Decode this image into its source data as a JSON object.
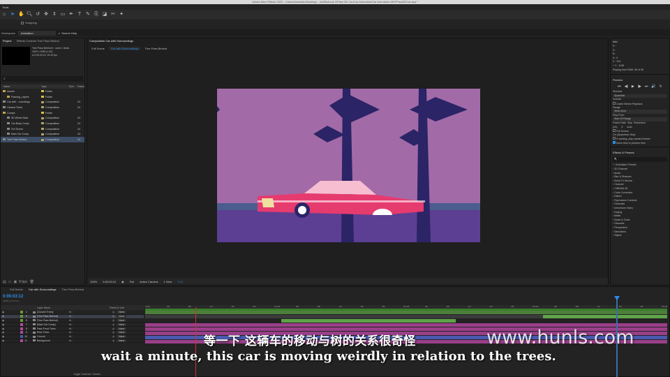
{
  "window": {
    "title": "Adobe After Effects 2023 - /Users/shunlsdn/Desktop/.../to/Bitchunk 2/Pass 3D Car/Car Animation/Car Animation AE/FPass3DCar.aep *"
  },
  "tools": {
    "label": "Tools",
    "items": [
      "home-icon",
      "selection-icon",
      "hand-icon",
      "zoom-icon",
      "orbit-icon",
      "pan-icon",
      "dolly-icon",
      "rectangle-icon",
      "pen-icon",
      "type-icon",
      "brush-icon",
      "clone-icon",
      "eraser-icon",
      "roto-icon",
      "puppet-icon"
    ],
    "snapping_label": "Snapping"
  },
  "workspace": {
    "label": "Workspace",
    "current": "Animation",
    "search_placeholder": "Search Help"
  },
  "project": {
    "tabs": [
      "Project",
      "Effects Controls Tree Pass Behind"
    ],
    "selected_name": "Tree Pass Behind ▾ , used 1 times",
    "selected_size": "1920 x 1080 (1.00)",
    "selected_duration": "Δ 0:00:03:10, 24.00 fps",
    "columns": [
      "Name",
      "Type",
      "Size",
      "Frame"
    ],
    "rows": [
      {
        "name": "Assets",
        "type": "Folder",
        "size": "",
        "kind": "folder",
        "indent": 0,
        "swatch": "#d8c14a"
      },
      {
        "name": "Flaming_Layers",
        "type": "Folder",
        "size": "",
        "kind": "folder",
        "indent": 1,
        "swatch": "#d8c14a"
      },
      {
        "name": "Car with ...roundings",
        "type": "Composition",
        "size": "24",
        "kind": "comp",
        "indent": 0,
        "swatch": "#b0a46a"
      },
      {
        "name": "Closest Trees",
        "type": "Composition",
        "size": "24",
        "kind": "comp",
        "indent": 0,
        "swatch": "#b0a46a"
      },
      {
        "name": "Comps",
        "type": "Folder",
        "size": "",
        "kind": "folder",
        "indent": 0,
        "swatch": "#d8c14a"
      },
      {
        "name": "3D Wheel Start",
        "type": "Composition",
        "size": "24",
        "kind": "comp",
        "indent": 1,
        "swatch": "#b0a46a"
      },
      {
        "name": "Car Body Comp",
        "type": "Composition",
        "size": "24",
        "kind": "comp",
        "indent": 1,
        "swatch": "#b0a46a"
      },
      {
        "name": "Full Scene",
        "type": "Composition",
        "size": "24",
        "kind": "comp",
        "indent": 1,
        "swatch": "#b0a46a"
      },
      {
        "name": "Main Car Comp",
        "type": "Composition",
        "size": "24",
        "kind": "comp",
        "indent": 1,
        "swatch": "#b0a46a"
      },
      {
        "name": "Tree Pass Behind",
        "type": "Composition",
        "size": "24",
        "kind": "comp",
        "indent": 0,
        "swatch": "#b0a46a",
        "selected": true
      }
    ],
    "footer_bpc": "8 bpc"
  },
  "viewer": {
    "tab_label": "Composition Car with Surroundings",
    "breadcrumbs": [
      "Full Scene",
      "Car with Surroundings",
      "Tree Pass Behind"
    ],
    "current_breadcrumb": "Car with Surroundings",
    "footer": {
      "zoom": "100%",
      "timecode": "0:00:03:12",
      "resolution": "Full",
      "camera": "Active Camera",
      "views": "1 View",
      "exposure": "+0.0"
    },
    "colors": {
      "sky": "#a36aa8",
      "ground": "#5c3f92",
      "horizon": "#4a5d8e",
      "trees": "#2b2466",
      "car": "#e63b6e",
      "car_roof": "#f6bed0"
    }
  },
  "info": {
    "title": "Info",
    "lines": [
      "R :",
      "G :",
      "B :",
      "A : 0",
      "X : 312",
      "+ Y : 1138",
      "Playing from RAM: 38 of 96"
    ]
  },
  "preview": {
    "title": "Preview",
    "transport": [
      "⏮",
      "◀|",
      "▶",
      "|▶",
      "⏭",
      "🔊",
      "↻"
    ],
    "shortcut_label": "Shortcut",
    "shortcut_value": "Spacebar",
    "include_label": "Include:",
    "cache_label": "Cache Before Playback",
    "range_label": "Range",
    "range_value": "Work Area",
    "play_from_label": "Play From",
    "play_from_value": "Start Of Range",
    "frame_rate_label": "Frame Rate",
    "skip_label": "Skip",
    "resolution_label": "Resolution",
    "frame_rate_value": "(24)",
    "skip_value": "0",
    "resolution_value": "Auto",
    "fullscreen_label": "Full Screen",
    "stop_label": "On (Spacebar) Stop:",
    "stop_opt1": "If caching, play cached frames",
    "stop_opt2": "Move time to preview time"
  },
  "effects": {
    "title": "Effects & Presets",
    "search_placeholder": "🔍",
    "items": [
      "* Animation Presets",
      "3D Channel",
      "Audio",
      "Blur & Sharpen",
      "Boris FX Mocha",
      "Channel",
      "CINEMA 4D",
      "Color Correction",
      "Distort",
      "Expression Controls",
      "Generate",
      "Immersive Video",
      "Keying",
      "Matte",
      "Noise & Grain",
      "Obsolete",
      "Perspective",
      "Simulation",
      "Stylize"
    ]
  },
  "timeline": {
    "tabs": [
      "Full Scene",
      "Car with Surroundings",
      "Tree Pass Behind"
    ],
    "active_tab": "Car with Surroundings",
    "timecode": "0:00:03:12",
    "fps_note": "00084 (24.00 fps)",
    "columns": {
      "layer_name": "Layer Name",
      "parent": "Parent & Link"
    },
    "ruler": [
      "0:00f",
      "04f",
      "08f",
      "12f",
      "16f",
      "20f",
      "01:00f",
      "04f",
      "08f",
      "12f",
      "16f",
      "20f",
      "02:00f",
      "04f",
      "08f",
      "12f",
      "16f",
      "20f",
      "03:00f",
      "04f",
      "08f",
      "12f",
      "16f",
      "20f",
      "04:00f"
    ],
    "layers": [
      {
        "num": "4",
        "name": "[Closest Trees]",
        "parent": "None",
        "color": "#6b9a3b"
      },
      {
        "num": "5",
        "name": "[Tree Pass Behind]",
        "parent": "None",
        "color": "#6b9a3b",
        "selected": true
      },
      {
        "num": "6",
        "name": "[Tree Pass Behind]",
        "parent": "None",
        "color": "#6b9a3b"
      },
      {
        "num": "7",
        "name": "[Main Car Comp]",
        "parent": "None",
        "color": "#b04a9c"
      },
      {
        "num": "8",
        "name": "Pass Front Trees",
        "parent": "None",
        "color": "#b04a9c"
      },
      {
        "num": "9",
        "name": "Rear Trees",
        "parent": "None",
        "color": "#b04a9c"
      },
      {
        "num": "10",
        "name": "Ground",
        "parent": "None",
        "color": "#4a5ab0"
      },
      {
        "num": "11",
        "name": "Background",
        "parent": "None",
        "color": "#b04a9c"
      }
    ],
    "footer": "Toggle Switches / Modes"
  },
  "subtitles": {
    "chinese": "等一下 这辆车的移动与树的关系很奇怪",
    "english": "wait a minute, this car is moving weirdly in relation to the trees."
  },
  "watermark": "www.hunls.com"
}
